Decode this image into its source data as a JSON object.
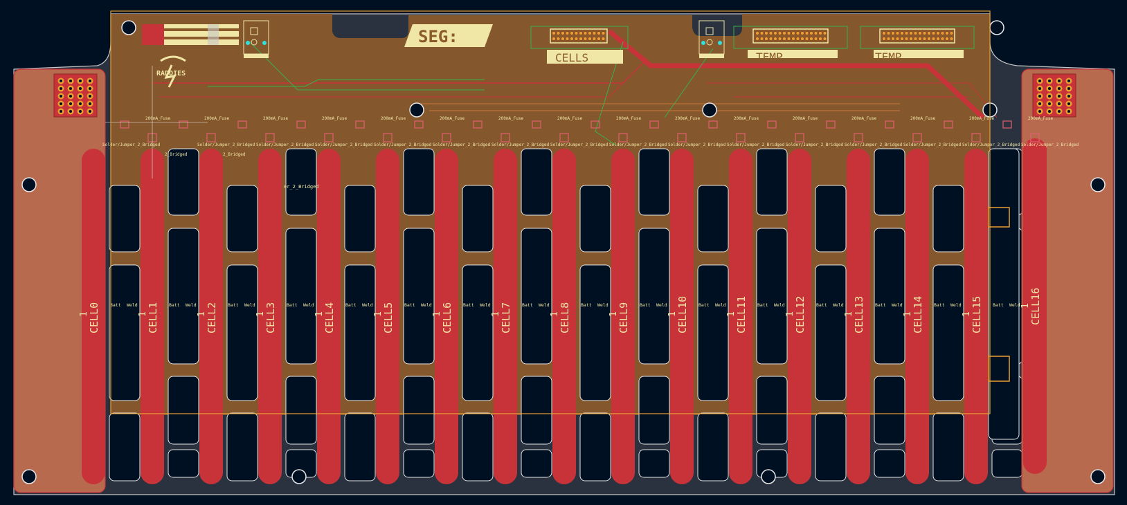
{
  "colors": {
    "background": "#001023",
    "board_edge": "#c8c8c8",
    "copper_back": "#2a3240",
    "copper_front": "#8a5a2b",
    "busbar": "#c8333a",
    "side_pad": "#b86a4f",
    "silkscreen": "#f0e7a6",
    "courtyard": "#e8a030",
    "trace": "#c8333a",
    "trace_green": "#38b24a",
    "fab_outline": "#c97a3a"
  },
  "labels": {
    "segment": "SEG:",
    "cells_connector": "CELLS",
    "temp_connector_1": "TEMP",
    "temp_connector_2": "TEMP",
    "logo": "RADDIES",
    "fuse_label": "200mA_Fuse",
    "jumper_label": "Solder/Jumper_2_Bridged",
    "jumper_label_short": "2_Bridged",
    "weld_label": "Weld",
    "batt_label": "Batt",
    "bridged_note": "er_2_Bridged",
    "bus_number": "1"
  },
  "cells": [
    "CELL0",
    "CELL1",
    "CELL2",
    "CELL3",
    "CELL4",
    "CELL5",
    "CELL6",
    "CELL7",
    "CELL8",
    "CELL9",
    "CELL10",
    "CELL11",
    "CELL12",
    "CELL13",
    "CELL14",
    "CELL15",
    "CELL16"
  ]
}
